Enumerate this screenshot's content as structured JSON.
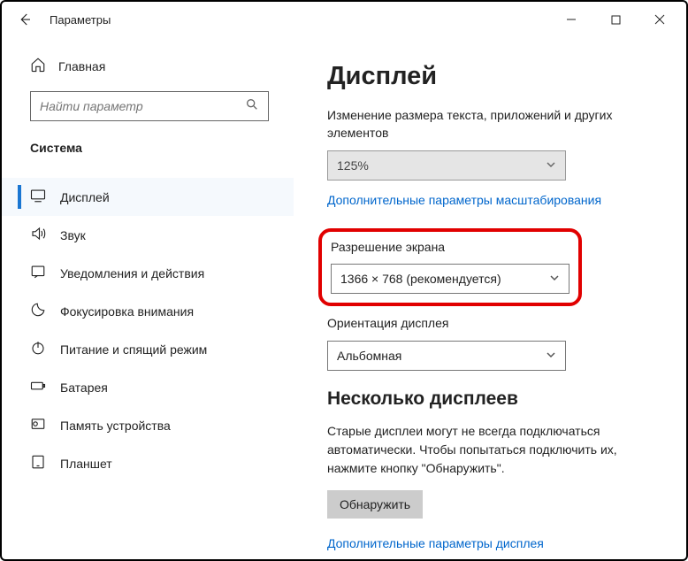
{
  "window": {
    "title": "Параметры"
  },
  "sidebar": {
    "home": "Главная",
    "search_placeholder": "Найти параметр",
    "section": "Система",
    "items": [
      {
        "label": "Дисплей"
      },
      {
        "label": "Звук"
      },
      {
        "label": "Уведомления и действия"
      },
      {
        "label": "Фокусировка внимания"
      },
      {
        "label": "Питание и спящий режим"
      },
      {
        "label": "Батарея"
      },
      {
        "label": "Память устройства"
      },
      {
        "label": "Планшет"
      }
    ]
  },
  "main": {
    "heading": "Дисплей",
    "scale_label": "Изменение размера текста, приложений и других элементов",
    "scale_value": "125%",
    "scale_link": "Дополнительные параметры масштабирования",
    "res_label": "Разрешение экрана",
    "res_value": "1366 × 768 (рекомендуется)",
    "orient_label": "Ориентация дисплея",
    "orient_value": "Альбомная",
    "multi_heading": "Несколько дисплеев",
    "multi_help": "Старые дисплеи могут не всегда подключаться автоматически. Чтобы попытаться подключить их, нажмите кнопку \"Обнаружить\".",
    "detect_btn": "Обнаружить",
    "adv_link": "Дополнительные параметры дисплея"
  }
}
